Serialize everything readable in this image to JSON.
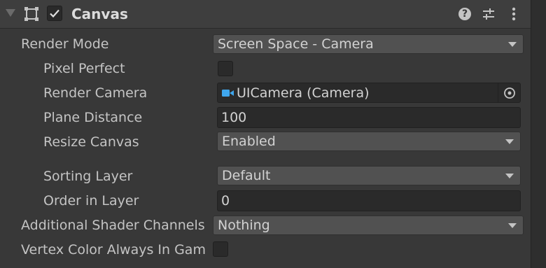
{
  "component": {
    "title": "Canvas",
    "enabled": true,
    "icons": [
      "foldout-arrow",
      "canvas-icon",
      "help-icon",
      "presets-icon",
      "menu-icon"
    ]
  },
  "fields": {
    "render_mode": {
      "label": "Render Mode",
      "value": "Screen Space - Camera"
    },
    "pixel_perfect": {
      "label": "Pixel Perfect",
      "checked": false
    },
    "render_camera": {
      "label": "Render Camera",
      "value": "UICamera (Camera)",
      "icon": "camera-icon"
    },
    "plane_distance": {
      "label": "Plane Distance",
      "value": "100"
    },
    "resize_canvas": {
      "label": "Resize Canvas",
      "value": "Enabled"
    },
    "sorting_layer": {
      "label": "Sorting Layer",
      "value": "Default"
    },
    "order_in_layer": {
      "label": "Order in Layer",
      "value": "0"
    },
    "additional_shader_channels": {
      "label": "Additional Shader Channels",
      "value": "Nothing"
    },
    "vertex_color_always_in_gamma": {
      "label": "Vertex Color Always In Gam",
      "checked": false
    }
  },
  "colors": {
    "background": "#383838",
    "header": "#3e3e3e",
    "field": "#2a2a2a",
    "dropdown": "#515151",
    "text": "#c4c4c4",
    "camera_icon": "#3fa7ee"
  }
}
